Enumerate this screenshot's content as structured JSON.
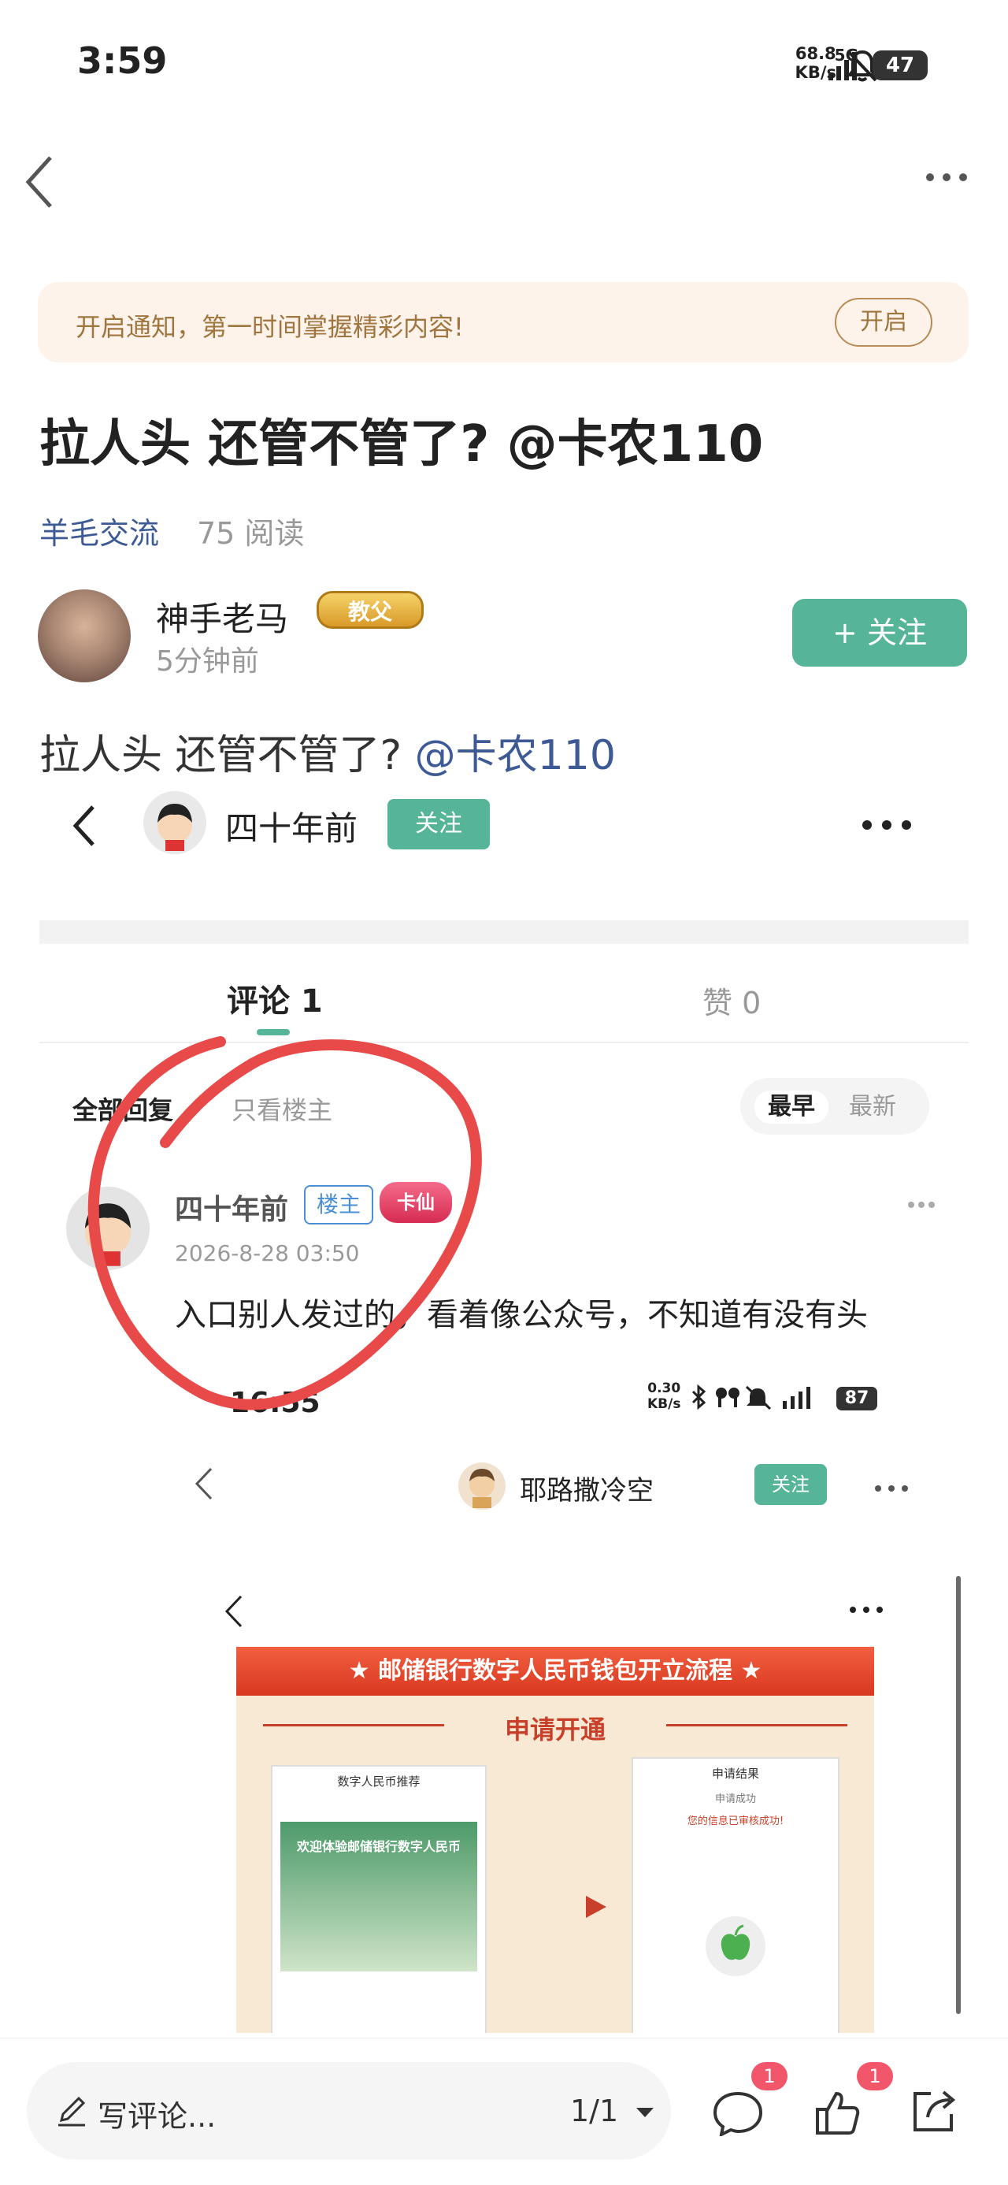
{
  "status_bar": {
    "time": "3:59",
    "net_speed_value": "68.8",
    "net_speed_unit": "KB/s",
    "network": "5G",
    "battery": "47"
  },
  "notification": {
    "text": "开启通知，第一时间掌握精彩内容!",
    "button": "开启"
  },
  "post": {
    "title": "拉人头 还管不管了? @卡农110",
    "category": "羊毛交流",
    "read_count": "75 阅读",
    "author": "神手老马",
    "author_badge": "教父",
    "time": "5分钟前",
    "follow_label": "+ 关注",
    "body_prefix": "拉人头 还管不管了? ",
    "body_mention": "@卡农110"
  },
  "screenshot": {
    "header_name": "四十年前",
    "header_follow": "关注",
    "tab_comments": "评论 1",
    "tab_likes": "赞 0",
    "filter_all": "全部回复",
    "filter_op": "只看楼主",
    "sort_early": "最早",
    "sort_new": "最新",
    "comment": {
      "name": "四十年前",
      "op_tag": "楼主",
      "badge": "卡仙",
      "time": "2026-8-28 03:50",
      "text": "入口别人发过的，看着像公众号，不知道有没有头"
    },
    "nested_status": {
      "time": "16:55",
      "speed_value": "0.30",
      "speed_unit": "KB/s",
      "battery": "87"
    },
    "nested_header_name": "耶路撒冷空",
    "nested_follow": "关注",
    "poster": {
      "banner": "★ 邮储银行数字人民币钱包开立流程 ★",
      "section": "申请开通",
      "left_title": "数字人民币推荐",
      "left_hero": "欢迎体验邮储银行数字人民币",
      "right_title": "申请结果",
      "right_sub": "申请成功",
      "right_ok": "您的信息已审核成功!"
    }
  },
  "bottom_bar": {
    "placeholder": "写评论...",
    "page": "1/1",
    "comment_count": "1",
    "like_count": "1"
  },
  "colors": {
    "accent_green": "#56b598",
    "link_blue": "#3d5a95",
    "badge_red": "#f2566b",
    "notify_bg": "#fdf3ea"
  }
}
